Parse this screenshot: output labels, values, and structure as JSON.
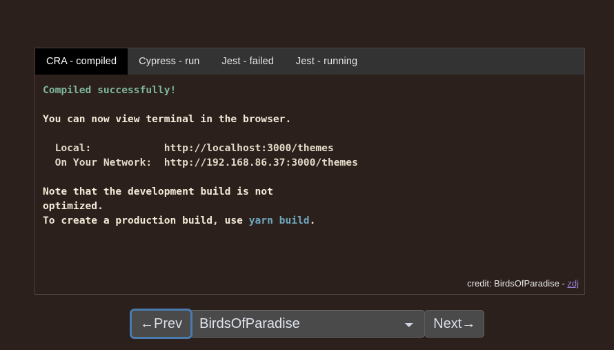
{
  "theme": {
    "page_background": "#2b201c",
    "tabbar_background": "#333333",
    "active_tab_background": "#000000",
    "accent_focus_ring": "#4a7bae",
    "link_color": "#9b7fd4",
    "success_color": "#7fb69c",
    "command_color": "#6fa8bc",
    "text_color": "#f4ead8"
  },
  "tabs": [
    {
      "label": "CRA - compiled",
      "active": true
    },
    {
      "label": "Cypress - run",
      "active": false
    },
    {
      "label": "Jest - failed",
      "active": false
    },
    {
      "label": "Jest - running",
      "active": false
    }
  ],
  "terminal": {
    "lines": [
      {
        "text": "Compiled successfully!",
        "class": "c-green"
      },
      {
        "text": " ",
        "class": "blank"
      },
      {
        "text": "You can now view terminal in the browser.",
        "class": "c-cream"
      },
      {
        "text": " ",
        "class": "blank"
      },
      {
        "text": "  Local:            http://localhost:3000/themes",
        "class": "c-dim"
      },
      {
        "text": "  On Your Network:  http://192.168.86.37:3000/themes",
        "class": "c-dim"
      },
      {
        "text": " ",
        "class": "blank"
      },
      {
        "text": "Note that the development build is not",
        "class": "c-cream"
      },
      {
        "text": "optimized.",
        "class": "c-cream"
      },
      {
        "text": "To create a production build, use ",
        "class": "c-cream",
        "suffix": "yarn build",
        "suffix_class": "c-cyan",
        "tail": "."
      }
    ]
  },
  "credit": {
    "prefix": "credit: BirdsOfParadise - ",
    "link_label": "zdj"
  },
  "controls": {
    "prev_label": "←Prev",
    "next_label": "Next→",
    "selected_theme": "BirdsOfParadise",
    "theme_options": [
      "BirdsOfParadise"
    ]
  }
}
